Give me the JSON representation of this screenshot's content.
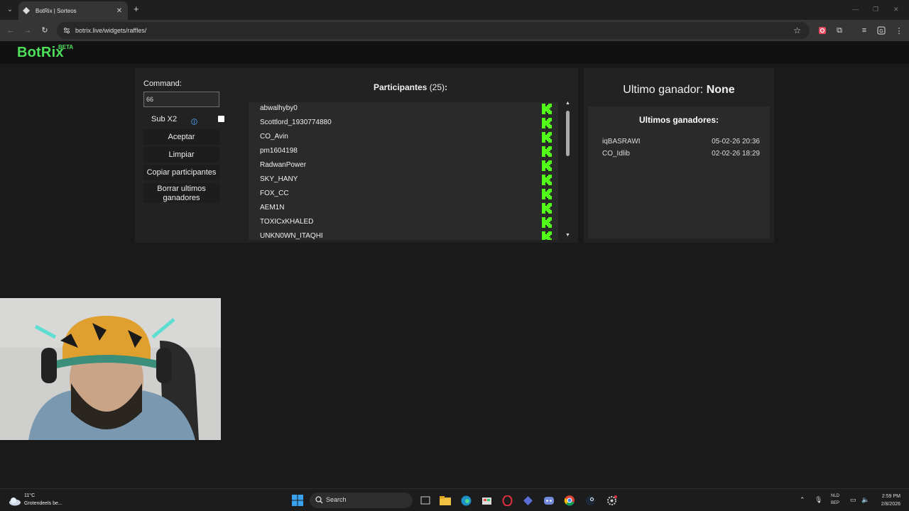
{
  "browser": {
    "tab_title": "BotRix | Sorteos",
    "url": "botrix.live/widgets/raffles/"
  },
  "site": {
    "logo": "BotRix",
    "badge": "BETA"
  },
  "controls": {
    "command_label": "Command:",
    "command_value": "66",
    "sub_x2_label": "Sub X2",
    "sub_x2_checked": false,
    "accept": "Aceptar",
    "clear": "Limpiar",
    "copy": "Copiar participantes",
    "clear_winners_line1": "Borrar ultimos",
    "clear_winners_line2": "ganadores"
  },
  "participants": {
    "title": "Participantes",
    "count": "(25)",
    "colon": ":",
    "names": [
      "abwalhyby0",
      "Scottlord_1930774880",
      "CO_Avin",
      "pm1604198",
      "RadwanPower",
      "SKY_HANY",
      "FOX_CC",
      "AEM1N",
      "TOXICxKHALED",
      "UNKN0WN_ITAQHI"
    ],
    "platform_icon": "kick-icon",
    "platform_color": "#53fc18"
  },
  "last_winner": {
    "label": "Ultimo ganador:",
    "value": "None"
  },
  "winners": {
    "title": "Ultimos ganadores:",
    "rows": [
      {
        "name": "iqBASRAWI",
        "date": "05-02-26 20:36"
      },
      {
        "name": "CO_Idlib",
        "date": "02-02-26 18:29"
      }
    ]
  },
  "taskbar": {
    "temp": "11°C",
    "weather_desc": "Grotendeels be...",
    "search": "Search",
    "lang1": "NLD",
    "lang2": "BEP",
    "time": "2:59 PM",
    "date": "2/8/2026"
  },
  "colors": {
    "accent": "#4ee05a",
    "kick_green": "#53fc18",
    "info_blue": "#4a90e2"
  }
}
